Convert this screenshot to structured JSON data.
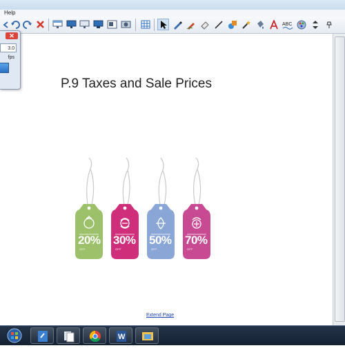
{
  "menu": {
    "help_label": "Help"
  },
  "toolbar": {
    "tools": [
      "back-icon",
      "undo-icon",
      "redo-icon",
      "delete-icon",
      "screen-shade-icon",
      "display-icon",
      "display-alt-icon",
      "monitor-icon",
      "capture-icon",
      "document-camera-icon",
      "table-icon",
      "select-icon",
      "pen-icon",
      "creative-pen-icon",
      "eraser-icon",
      "line-icon",
      "shape-icon",
      "magic-pen-icon",
      "fill-icon",
      "text-icon",
      "recognition-icon",
      "properties-icon",
      "more-icon"
    ]
  },
  "recorder": {
    "close_label": "✕",
    "fps_value": "3.0 fps"
  },
  "page": {
    "title": "P.9 Taxes and Sale Prices",
    "extend_link": "Extend Page"
  },
  "tags": [
    {
      "label": "20%",
      "sub": "OFF",
      "color": "#9dc06a",
      "dark": "#7fa44c"
    },
    {
      "label": "30%",
      "sub": "OFF",
      "color": "#cf2e7a",
      "dark": "#a81d5e"
    },
    {
      "label": "50%",
      "sub": "OFF",
      "color": "#8aa6d6",
      "dark": "#6d89bd"
    },
    {
      "label": "70%",
      "sub": "OFF",
      "color": "#c84a92",
      "dark": "#a43274"
    }
  ],
  "taskbar": {
    "apps": [
      "start-icon",
      "network-icon",
      "notebook-icon",
      "files-icon",
      "chrome-icon",
      "word-icon",
      "explorer-icon"
    ]
  }
}
